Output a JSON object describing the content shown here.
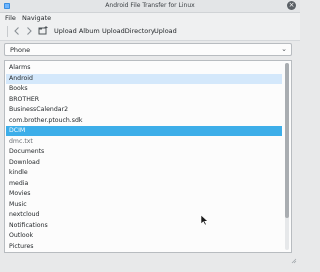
{
  "window": {
    "title": "Android File Transfer for Linux"
  },
  "menu": {
    "file": "File",
    "navigate": "Navigate"
  },
  "toolbar": {
    "back_icon": "chevron-left-icon",
    "forward_icon": "chevron-right-icon",
    "upload_album": "Upload Album",
    "upload_directory": "UploadDirectory",
    "upload": "Upload"
  },
  "device": {
    "selected": "Phone"
  },
  "files": [
    {
      "name": "Alarms",
      "state": "normal"
    },
    {
      "name": "Android",
      "state": "hover"
    },
    {
      "name": "Books",
      "state": "normal"
    },
    {
      "name": "BROTHER",
      "state": "normal"
    },
    {
      "name": "BusinessCalendar2",
      "state": "normal"
    },
    {
      "name": "com.brother.ptouch.sdk",
      "state": "normal"
    },
    {
      "name": "DCIM",
      "state": "selected"
    },
    {
      "name": "dmc.txt",
      "state": "file"
    },
    {
      "name": "Documents",
      "state": "normal"
    },
    {
      "name": "Download",
      "state": "normal"
    },
    {
      "name": "kindle",
      "state": "normal"
    },
    {
      "name": "media",
      "state": "normal"
    },
    {
      "name": "Movies",
      "state": "normal"
    },
    {
      "name": "Music",
      "state": "normal"
    },
    {
      "name": "nextcloud",
      "state": "normal"
    },
    {
      "name": "Notifications",
      "state": "normal"
    },
    {
      "name": "Outlook",
      "state": "normal"
    },
    {
      "name": "Pictures",
      "state": "normal"
    }
  ],
  "scroll": {
    "visible_fraction": 0.83,
    "position": 0.0
  },
  "colors": {
    "selection": "#3daee9",
    "hover": "#d4e8fb"
  }
}
